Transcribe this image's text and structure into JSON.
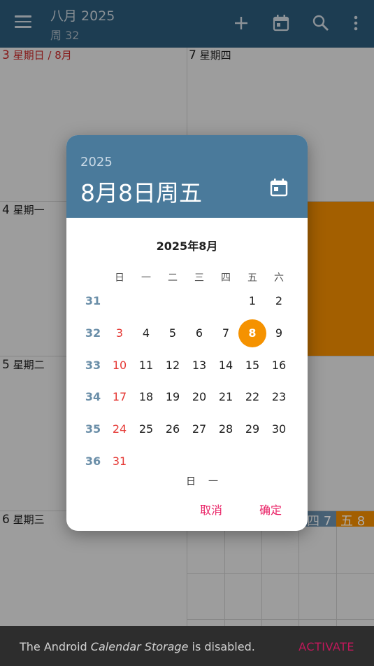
{
  "appbar": {
    "title": "八月 2025",
    "subtitle": "周 32",
    "icons": [
      "menu-icon",
      "add-icon",
      "calendar-today-icon",
      "search-icon",
      "more-vert-icon"
    ]
  },
  "background": {
    "cells": [
      {
        "num": "3",
        "label": "星期日 / 8月"
      },
      {
        "num": "7",
        "label": "星期四"
      },
      {
        "num": "4",
        "label": "星期一"
      },
      {
        "num": "5",
        "label": "星期二"
      },
      {
        "num": "6",
        "label": "星期三"
      }
    ],
    "week_strip": [
      {
        "text": "四 7"
      },
      {
        "text": "五 8"
      }
    ]
  },
  "dialog": {
    "year": "2025",
    "selected_date": "8月8日周五",
    "month_title": "2025年8月",
    "weekdays": [
      "日",
      "一",
      "二",
      "三",
      "四",
      "五",
      "六"
    ],
    "weeks": [
      {
        "week": "31",
        "days": [
          "",
          "",
          "",
          "",
          "",
          "1",
          "2"
        ]
      },
      {
        "week": "32",
        "days": [
          "3",
          "4",
          "5",
          "6",
          "7",
          "8",
          "9"
        ]
      },
      {
        "week": "33",
        "days": [
          "10",
          "11",
          "12",
          "13",
          "14",
          "15",
          "16"
        ]
      },
      {
        "week": "34",
        "days": [
          "17",
          "18",
          "19",
          "20",
          "21",
          "22",
          "23"
        ]
      },
      {
        "week": "35",
        "days": [
          "24",
          "25",
          "26",
          "27",
          "28",
          "29",
          "30"
        ]
      },
      {
        "week": "36",
        "days": [
          "31",
          "",
          "",
          "",
          "",
          "",
          ""
        ]
      }
    ],
    "selected_day": "8",
    "next_month_peek": [
      "日",
      "一"
    ],
    "cancel_label": "取消",
    "ok_label": "确定"
  },
  "snackbar": {
    "message_prefix": "The Android ",
    "message_em": "Calendar Storage",
    "message_suffix": " is disabled.",
    "action_label": "ACTIVATE"
  },
  "colors": {
    "appbar": "#2b5a7a",
    "dialog_header": "#4a7a9b",
    "selected": "#f59200",
    "sunday": "#e53935",
    "week_number": "#6a8ea8",
    "button": "#e91e63"
  }
}
